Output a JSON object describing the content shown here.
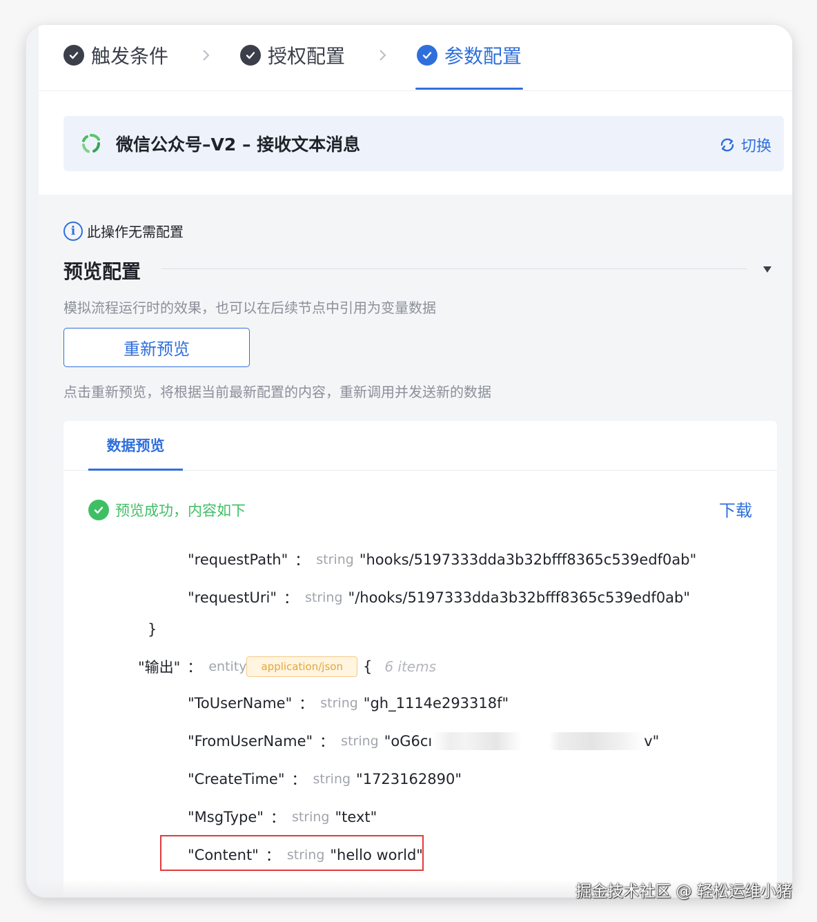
{
  "steps": [
    {
      "label": "触发条件"
    },
    {
      "label": "授权配置"
    },
    {
      "label": "参数配置"
    }
  ],
  "banner": {
    "title": "微信公众号–V2 – 接收文本消息",
    "switch_label": "切换"
  },
  "config": {
    "info_text": "此操作无需配置",
    "section_title": "预览配置",
    "description": "模拟流程运行时的效果，也可以在后续节点中引用为变量数据",
    "refresh_button": "重新预览",
    "refresh_hint": "点击重新预览，将根据当前最新配置的内容，重新调用并发送新的数据"
  },
  "panel": {
    "tab_label": "数据预览",
    "status_text": "预览成功，内容如下",
    "download_label": "下载"
  },
  "json": {
    "request_path": {
      "key": "\"requestPath\"",
      "type": "string",
      "value": "\"hooks/5197333dda3b32bfff8365c539edf0ab\""
    },
    "request_uri": {
      "key": "\"requestUri\"",
      "type": "string",
      "value": "\"/hooks/5197333dda3b32bfff8365c539edf0ab\""
    },
    "close_brace": "}",
    "output": {
      "key": "\"输出\"",
      "type": "entity",
      "badge": "application/json",
      "open_brace": "{",
      "items": "6 items"
    },
    "to_user": {
      "key": "\"ToUserName\"",
      "type": "string",
      "value": "\"gh_1114e293318f\""
    },
    "from_user": {
      "key": "\"FromUserName\"",
      "type": "string",
      "value_start": "\"oG6cı",
      "value_end": "v\""
    },
    "create_time": {
      "key": "\"CreateTime\"",
      "type": "string",
      "value": "\"1723162890\""
    },
    "msg_type": {
      "key": "\"MsgType\"",
      "type": "string",
      "value": "\"text\""
    },
    "content": {
      "key": "\"Content\"",
      "type": "string",
      "value": "\"hello world\""
    }
  },
  "colon": "：",
  "watermark": "掘金技术社区 @ 轻松运维小猪",
  "colors": {
    "accent": "#2f6fdc",
    "success": "#3fbf64",
    "highlight": "#e3393a",
    "badge_text": "#e5a53a"
  }
}
